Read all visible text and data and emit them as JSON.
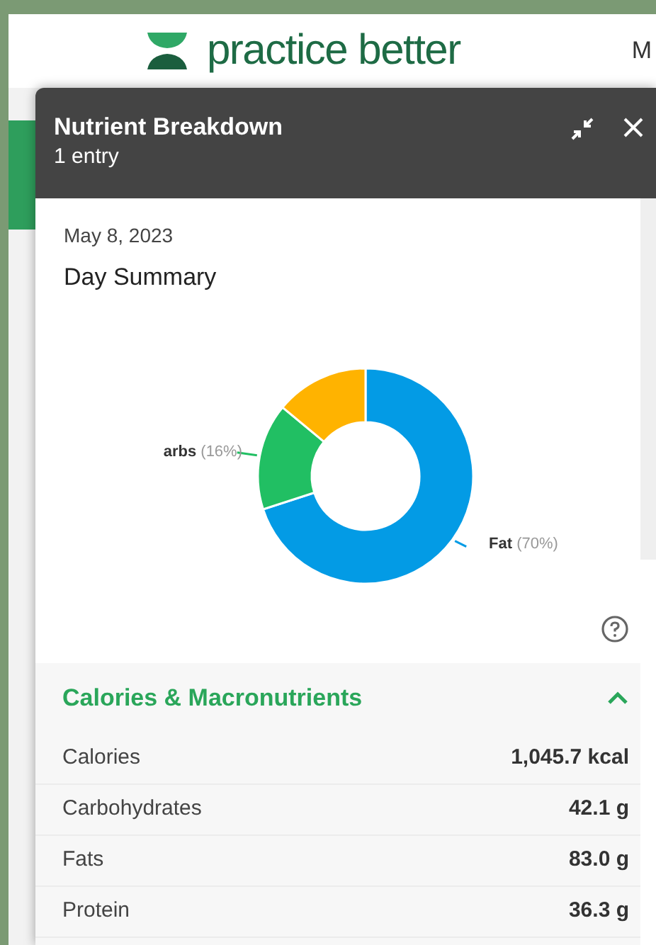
{
  "header": {
    "brand": "practice better",
    "nav_item": "M"
  },
  "dialog": {
    "title": "Nutrient Breakdown",
    "subtitle": "1 entry",
    "date": "May 8, 2023",
    "heading": "Day Summary",
    "chart_data": {
      "type": "donut",
      "categories": [
        "Fat",
        "arbs",
        null
      ],
      "values": [
        70,
        16,
        14
      ],
      "colors": [
        "#039be5",
        "#21bf63",
        "#ffb300"
      ],
      "value_labels": [
        "(70%)",
        "(16%)",
        null
      ]
    },
    "section": {
      "title": "Calories & Macronutrients",
      "expanded": true,
      "rows": [
        {
          "label": "Calories",
          "value": "1,045.7 kcal"
        },
        {
          "label": "Carbohydrates",
          "value": "42.1 g"
        },
        {
          "label": "Fats",
          "value": "83.0 g"
        },
        {
          "label": "Protein",
          "value": "36.3 g"
        }
      ]
    }
  }
}
